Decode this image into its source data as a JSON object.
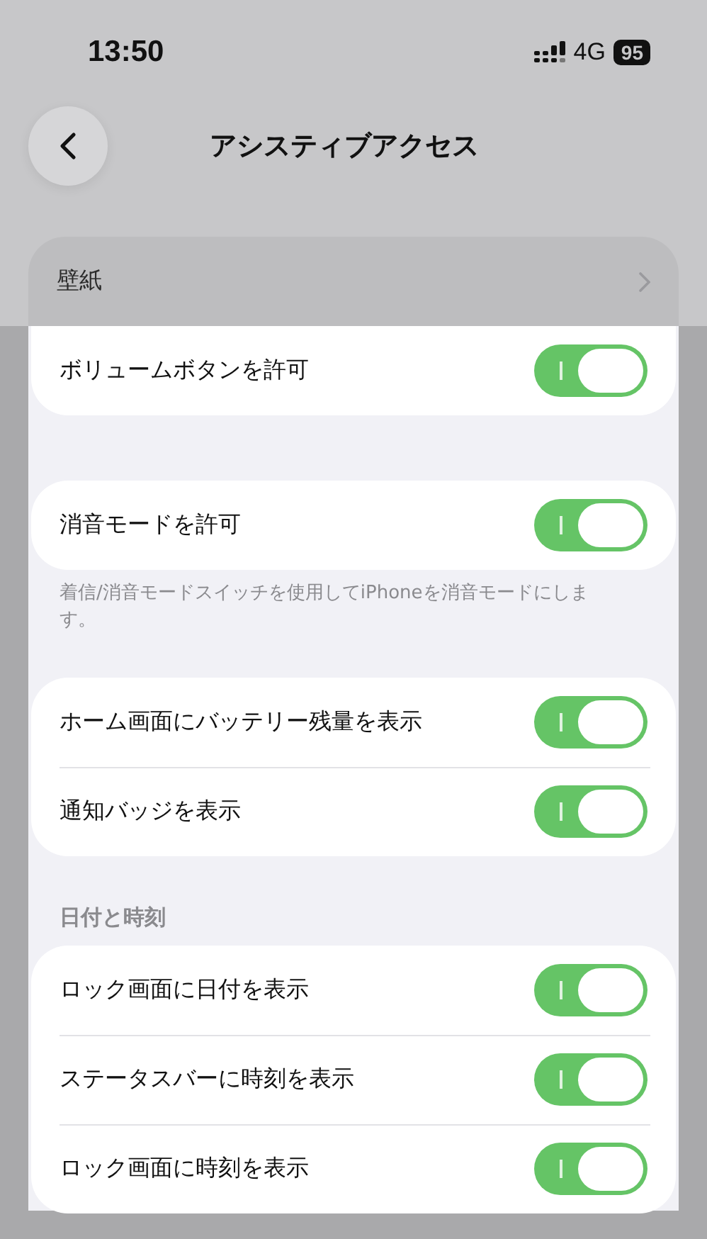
{
  "status_bar": {
    "time": "13:50",
    "network": "4G",
    "battery": "95"
  },
  "nav": {
    "title": "アシスティブアクセス"
  },
  "sections": [
    {
      "rows": [
        {
          "label": "壁紙",
          "kind": "link",
          "dimmed": true
        },
        {
          "label": "ボリュームボタンを許可",
          "kind": "toggle",
          "on": true,
          "dimmed": false
        }
      ]
    },
    {
      "rows": [
        {
          "label": "消音モードを許可",
          "kind": "toggle",
          "on": true,
          "dimmed": false
        }
      ],
      "footer": "着信/消音モードスイッチを使用してiPhoneを消音モードにします。"
    },
    {
      "rows": [
        {
          "label": "ホーム画面にバッテリー残量を表示",
          "kind": "toggle",
          "on": true,
          "dimmed": false
        },
        {
          "label": "通知バッジを表示",
          "kind": "toggle",
          "on": true,
          "dimmed": false
        }
      ]
    },
    {
      "header": "日付と時刻",
      "rows": [
        {
          "label": "ロック画面に日付を表示",
          "kind": "toggle",
          "on": true,
          "dimmed": false
        },
        {
          "label": "ステータスバーに時刻を表示",
          "kind": "toggle",
          "on": true,
          "dimmed": false
        },
        {
          "label": "ロック画面に時刻を表示",
          "kind": "toggle",
          "on": true,
          "dimmed": false
        }
      ]
    }
  ]
}
